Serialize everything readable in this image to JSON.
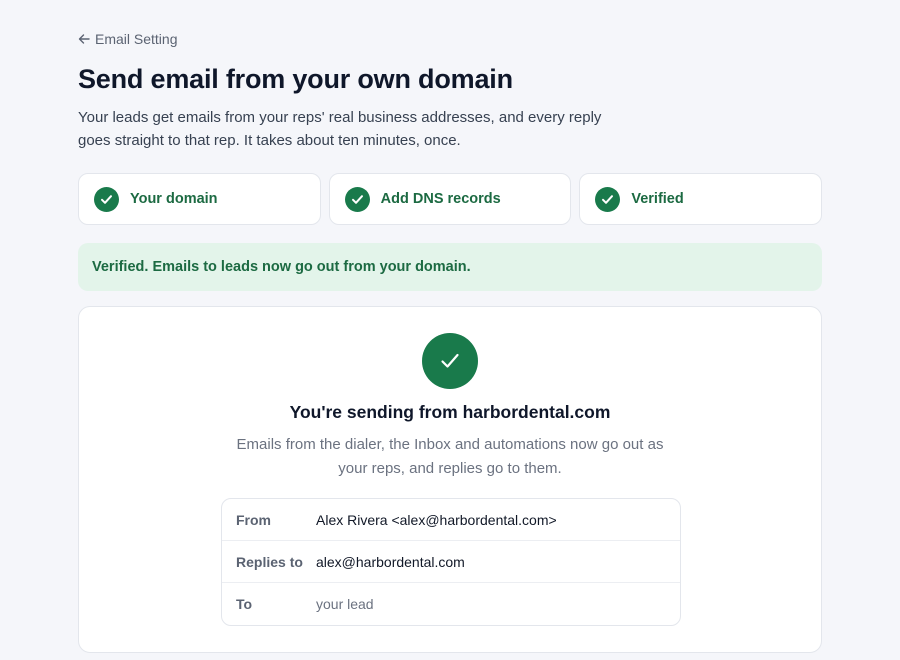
{
  "nav": {
    "back_label": "Email Setting",
    "back_icon": "arrow-left-icon"
  },
  "header": {
    "title": "Send email from your own domain",
    "description": "Your leads get emails from your reps' real business addresses, and every reply goes straight to that rep. It takes about ten minutes, once."
  },
  "steps": [
    {
      "label": "Your domain",
      "status": "complete",
      "icon": "check-icon"
    },
    {
      "label": "Add DNS records",
      "status": "complete",
      "icon": "check-icon"
    },
    {
      "label": "Verified",
      "status": "complete",
      "icon": "check-icon"
    }
  ],
  "alert": {
    "text": "Verified. Emails to leads now go out from your domain."
  },
  "card": {
    "icon": "check-icon",
    "title": "You're sending from harbordental.com",
    "description": "Emails from the dialer, the Inbox and automations now go out as your reps, and replies go to them.",
    "details": [
      {
        "label": "From",
        "value": "Alex Rivera <alex@harbordental.com>"
      },
      {
        "label": "Replies to",
        "value": "alex@harbordental.com"
      },
      {
        "label": "To",
        "value": "your lead"
      }
    ]
  },
  "colors": {
    "accent_green": "#197a4b",
    "success_text": "#1c6a42",
    "success_bg": "#e3f4ea",
    "page_bg": "#f5f6fa"
  }
}
